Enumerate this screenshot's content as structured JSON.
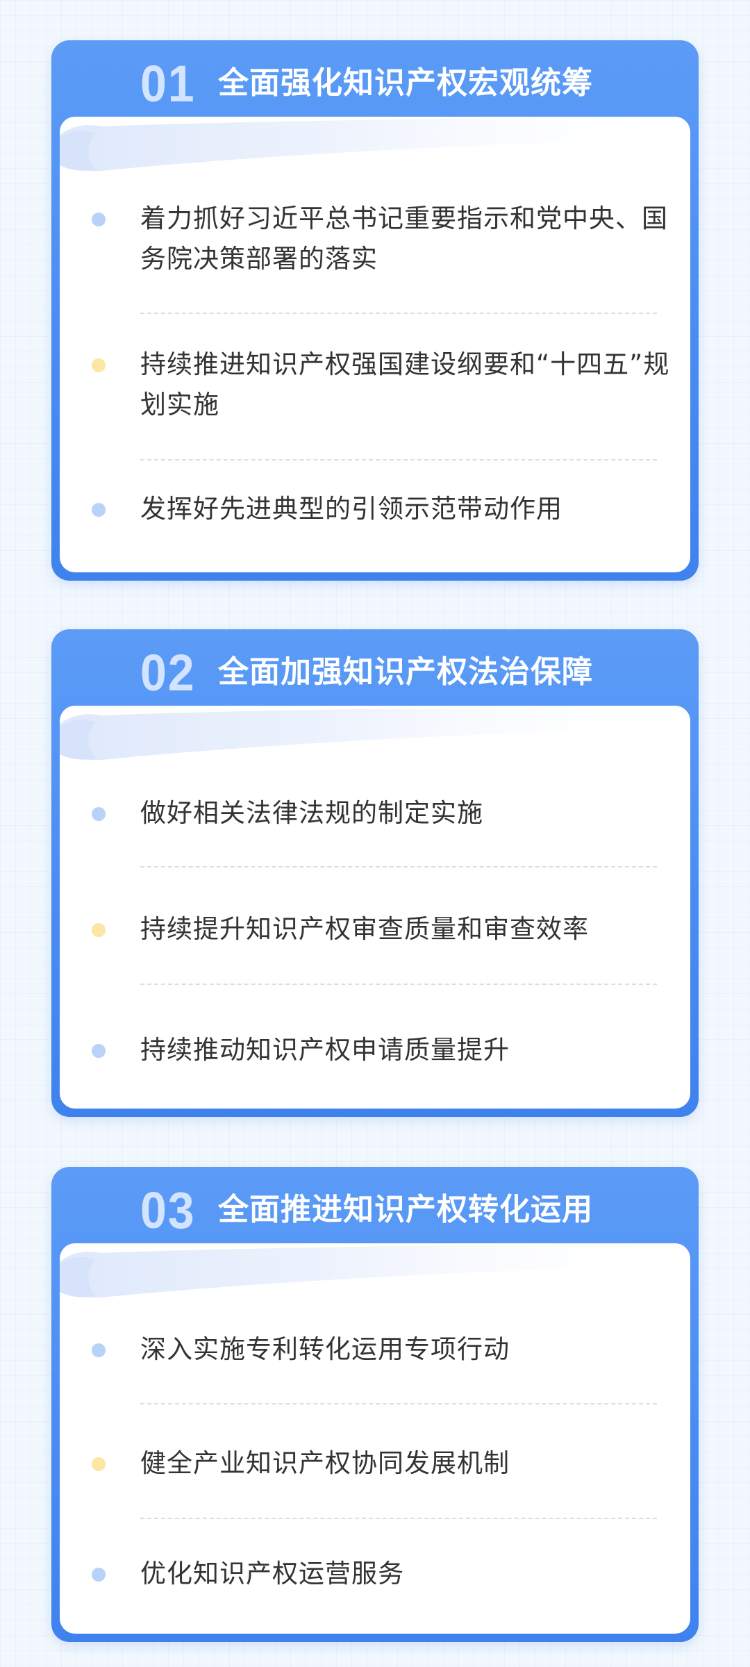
{
  "sections": [
    {
      "number": "01",
      "title": "全面强化知识产权宏观统筹",
      "items": [
        {
          "text": "着力抓好习近平总书记重要指示和党中央、国务院决策部署的落实",
          "bullet": "blue"
        },
        {
          "text": "持续推进知识产权强国建设纲要和“十四五”规划实施",
          "bullet": "yellow"
        },
        {
          "text": "发挥好先进典型的引领示范带动作用",
          "bullet": "blue"
        }
      ]
    },
    {
      "number": "02",
      "title": "全面加强知识产权法治保障",
      "items": [
        {
          "text": "做好相关法律法规的制定实施",
          "bullet": "blue"
        },
        {
          "text": "持续提升知识产权审查质量和审查效率",
          "bullet": "yellow"
        },
        {
          "text": "持续推动知识产权申请质量提升",
          "bullet": "blue"
        }
      ]
    },
    {
      "number": "03",
      "title": "全面推进知识产权转化运用",
      "items": [
        {
          "text": "深入实施专利转化运用专项行动",
          "bullet": "blue"
        },
        {
          "text": "健全产业知识产权协同发展机制",
          "bullet": "yellow"
        },
        {
          "text": "优化知识产权运营服务",
          "bullet": "blue"
        }
      ]
    }
  ],
  "colors": {
    "accent": "#4a8cf3",
    "bullet_blue": "#b9d2f8",
    "bullet_yellow": "#fbe6a3",
    "number": "#d2e4ff",
    "text": "#333333"
  }
}
